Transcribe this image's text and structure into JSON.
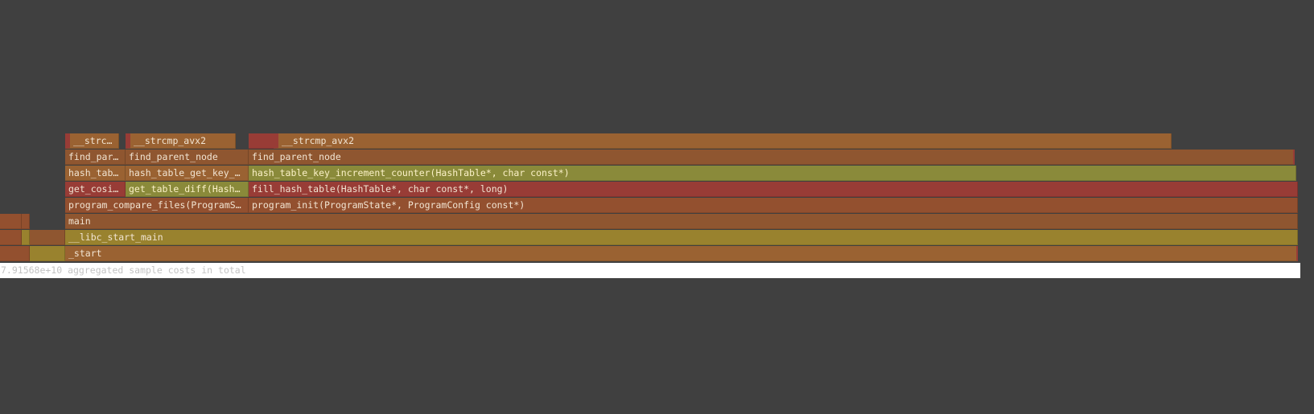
{
  "colors": {
    "background": "#404040",
    "brown": "#8f5630",
    "orange": "#9a6232",
    "red": "#983c36",
    "rust": "#93502f",
    "olive": "#8a8a3a",
    "mustard": "#99822e",
    "footer_bg": "#ffffff",
    "footer_text": "#c3c3c3"
  },
  "frames": [
    {
      "label": "__strcm…",
      "depth": 0,
      "color": "orange",
      "highlight": "red"
    },
    {
      "label": "__strcmp_avx2",
      "depth": 0,
      "color": "orange",
      "highlight": "red"
    },
    {
      "label": "",
      "depth": 0,
      "color": "red"
    },
    {
      "label": "__strcmp_avx2",
      "depth": 0,
      "color": "orange",
      "highlight": "red"
    },
    {
      "label": "find_pare…",
      "depth": 1,
      "color": "brown"
    },
    {
      "label": "find_parent_node",
      "depth": 1,
      "color": "brown"
    },
    {
      "label": "find_parent_node",
      "depth": 1,
      "color": "brown",
      "end_highlight": "red"
    },
    {
      "label": "hash_tabl…",
      "depth": 2,
      "color": "orange"
    },
    {
      "label": "hash_table_get_key_cou",
      "depth": 2,
      "color": "orange"
    },
    {
      "label": "hash_table_key_increment_counter(HashTable*, char const*)",
      "depth": 2,
      "color": "olive"
    },
    {
      "label": "get_cosine",
      "depth": 3,
      "color": "red"
    },
    {
      "label": "get_table_diff(HashTab",
      "depth": 3,
      "color": "olive"
    },
    {
      "label": "fill_hash_table(HashTable*, char const*, long)",
      "depth": 3,
      "color": "red"
    },
    {
      "label": "program_compare_files(ProgramState",
      "depth": 4,
      "color": "rust"
    },
    {
      "label": "program_init(ProgramState*, ProgramConfig const*)",
      "depth": 4,
      "color": "rust"
    },
    {
      "label": "",
      "depth": 5,
      "color": "rust"
    },
    {
      "label": "",
      "depth": 5,
      "color": "rust"
    },
    {
      "label": "main",
      "depth": 5,
      "color": "brown"
    },
    {
      "label": "",
      "depth": 6,
      "color": "rust"
    },
    {
      "label": "",
      "depth": 6,
      "color": "mustard"
    },
    {
      "label": "",
      "depth": 6,
      "color": "brown"
    },
    {
      "label": "__libc_start_main",
      "depth": 6,
      "color": "mustard"
    },
    {
      "label": "",
      "depth": 7,
      "color": "rust"
    },
    {
      "label": "",
      "depth": 7,
      "color": "mustard"
    },
    {
      "label": "_start",
      "depth": 7,
      "color": "orange",
      "end_highlight": "red"
    }
  ],
  "footer": {
    "text": "7.91568e+10 aggregated sample costs in total"
  }
}
